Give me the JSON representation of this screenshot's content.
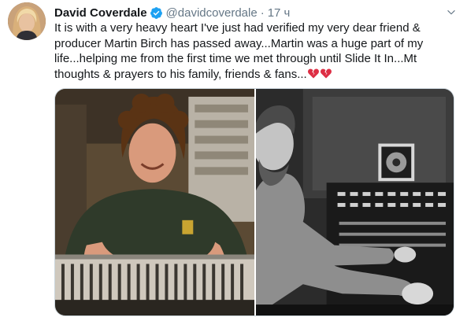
{
  "tweet": {
    "author_name": "David Coverdale",
    "handle": "@davidcoverdale",
    "separator": "·",
    "time": "17 ч",
    "text": "It is with a very heavy heart I've just had verified my very dear friend & producer Martin Birch has passed away...Martin was a huge part of my life...helping me from the first time we met through until Slide It In...Mt thoughts & prayers to his family, friends & fans...",
    "emojis": [
      "broken-heart-icon",
      "broken-heart-icon"
    ]
  },
  "media": {
    "photos": [
      {
        "name": "photo-martin-birch-color"
      },
      {
        "name": "photo-martin-birch-bw"
      }
    ]
  },
  "colors": {
    "verified": "#1da1f2",
    "secondary_text": "#657786",
    "broken_heart": "#dd2e44"
  }
}
